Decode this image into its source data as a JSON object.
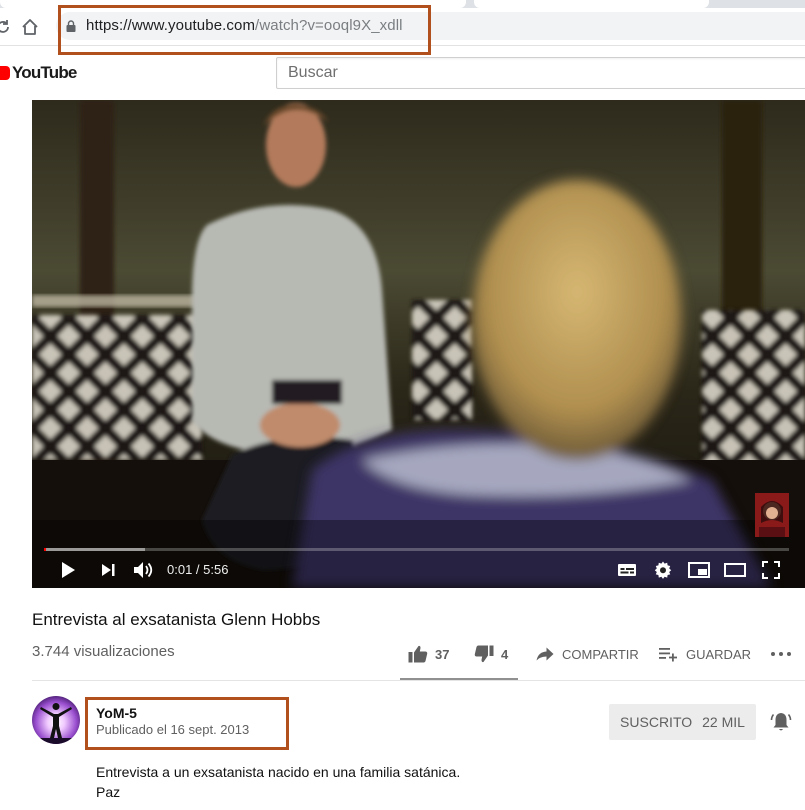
{
  "browser": {
    "url_host": "https://www.youtube.com",
    "url_path": "/watch?v=ooql9X_xdll"
  },
  "masthead": {
    "logo_text": "YouTube",
    "search_placeholder": "Buscar"
  },
  "player": {
    "current_time": "0:01",
    "duration": "5:56",
    "time_separator": " / ",
    "progress_fraction": 0.003,
    "buffered_fraction": 0.135
  },
  "video": {
    "title": "Entrevista al exsatanista Glenn Hobbs",
    "views": "3.744 visualizaciones"
  },
  "actions": {
    "like_count": "37",
    "dislike_count": "4",
    "share_label": "COMPARTIR",
    "save_label": "GUARDAR"
  },
  "owner": {
    "channel_name": "YoM-5",
    "published": "Publicado el 16 sept. 2013",
    "subscribe_label": "SUSCRITO",
    "subscriber_count": "22 MIL"
  },
  "description": {
    "line1": "Entrevista a un exsatanista nacido en una familia satánica.",
    "line2": "Paz"
  },
  "colors": {
    "youtube_red": "#ff0000",
    "annotation": "#b1501c"
  }
}
